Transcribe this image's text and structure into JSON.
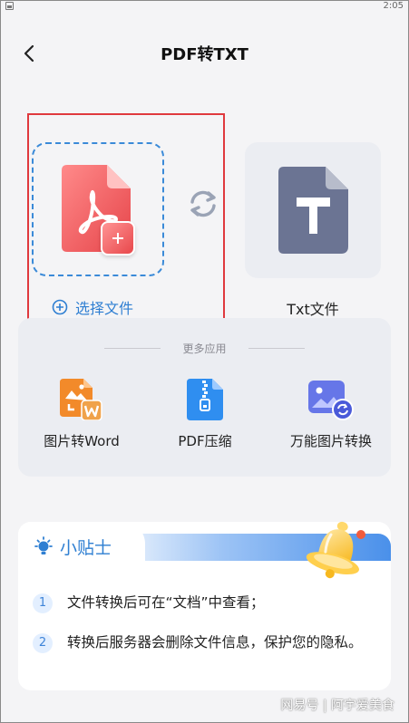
{
  "status_bar": {
    "time": "2:05"
  },
  "header": {
    "title": "PDF转TXT"
  },
  "source": {
    "select_label": "选择文件"
  },
  "target": {
    "label": "Txt文件"
  },
  "more_apps": {
    "title": "更多应用",
    "items": [
      {
        "label": "图片转Word",
        "icon": "image-to-word-icon"
      },
      {
        "label": "PDF压缩",
        "icon": "zip-compress-icon"
      },
      {
        "label": "万能图片转换",
        "icon": "image-convert-icon"
      }
    ]
  },
  "tips": {
    "title": "小贴士",
    "items": [
      {
        "num": "1",
        "text": "文件转换后可在“文档”中查看；"
      },
      {
        "num": "2",
        "text": "转换后服务器会删除文件信息，保护您的隐私。"
      }
    ]
  },
  "watermark": "网易号 | 阿宇爱美食",
  "colors": {
    "accent": "#2f7fd2",
    "highlight_frame": "#e0393e",
    "pdf_red": "#e8474b",
    "txt_slate": "#6b7493"
  }
}
